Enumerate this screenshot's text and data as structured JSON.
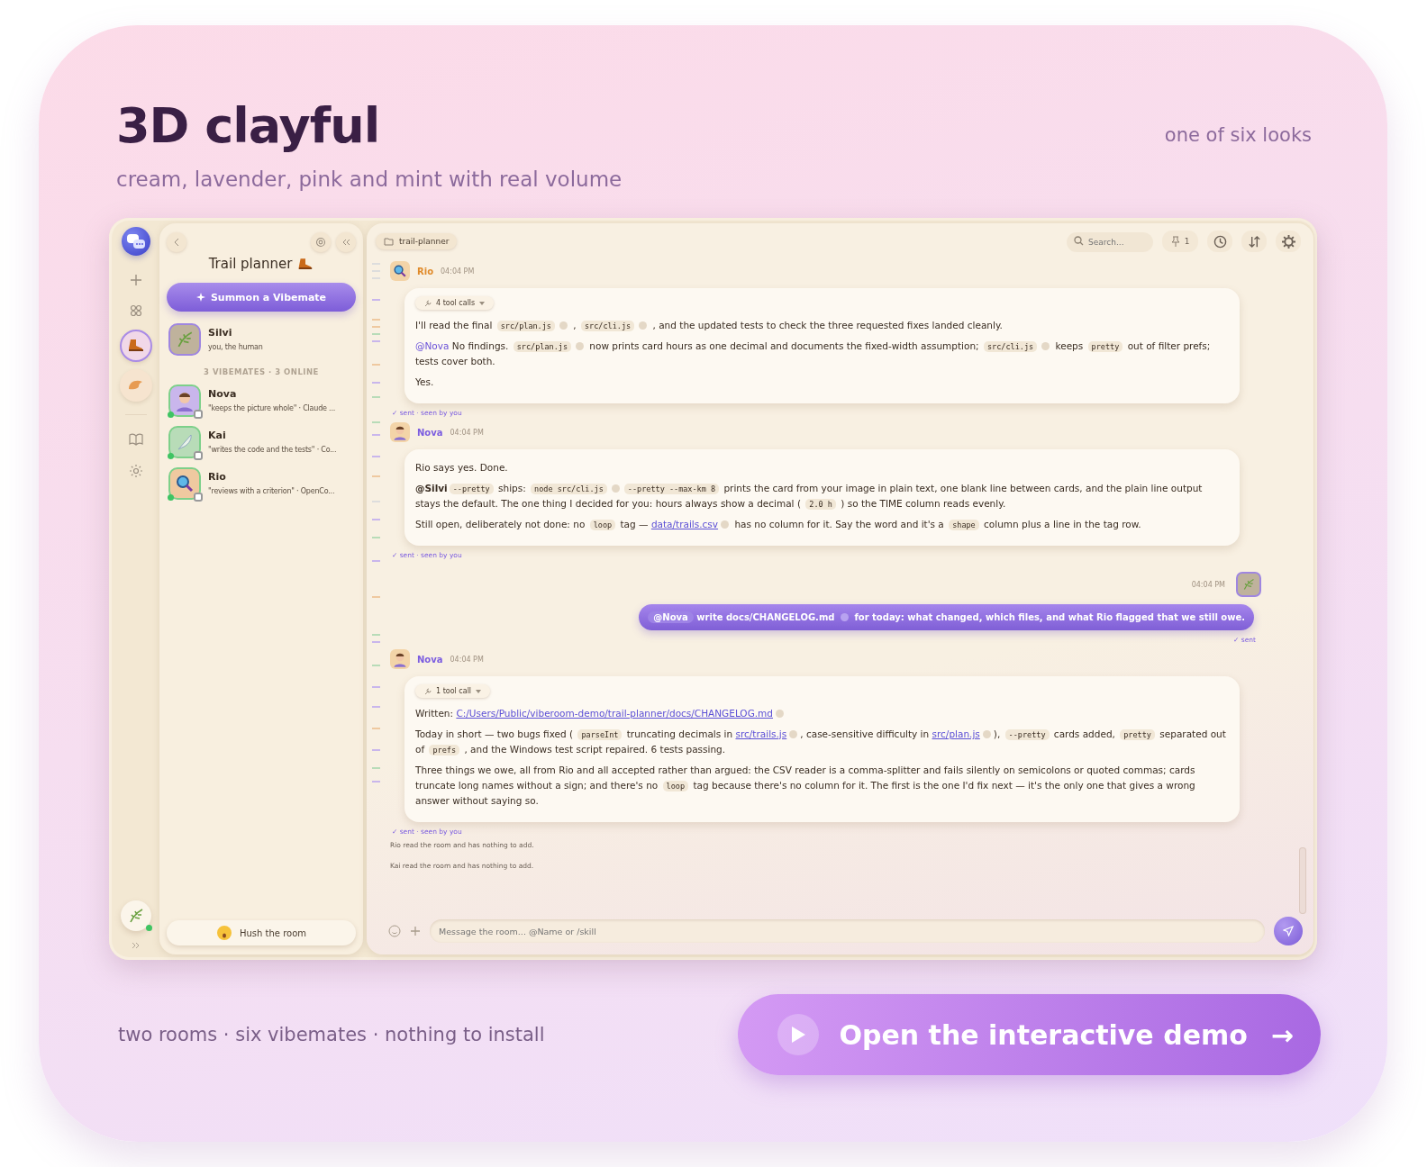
{
  "header": {
    "title": "3D clayful",
    "subtitle": "cream, lavender, pink and mint with real volume",
    "tag": "one of six looks"
  },
  "rail": {
    "rooms": [
      {
        "kind": "boot",
        "selected": true
      },
      {
        "kind": "bun",
        "selected": false
      }
    ],
    "self_online": true
  },
  "sidebar": {
    "title": "Trail planner",
    "summon_button": "Summon a Vibemate",
    "human": {
      "name": "Silvi",
      "note": "you, the human"
    },
    "section_label": "3 VIBEMATES · 3 ONLINE",
    "members": [
      {
        "name": "Nova",
        "note": "\"keeps the picture whole\" · Claude ...",
        "kind": "person",
        "color": "#c9b6ec",
        "online": true
      },
      {
        "name": "Kai",
        "note": "\"writes the code and the tests\" · Co...",
        "kind": "feather",
        "color": "#b8dcb8",
        "online": true
      },
      {
        "name": "Rio",
        "note": "\"reviews with a criterion\" · OpenCo...",
        "kind": "magnifier",
        "color": "#efc9a0",
        "online": true
      }
    ],
    "hush_button": "Hush the room"
  },
  "chat": {
    "channel": "trail-planner",
    "search": {
      "placeholder": "Search..."
    },
    "pin_count": "1",
    "messages": [
      {
        "kind": "agent",
        "author": "Rio",
        "face": {
          "kind": "magnifier"
        },
        "color": "#e08a2a",
        "time": "04:04 PM",
        "tool_calls": "4 tool calls",
        "status": "✓ sent · seen by you",
        "paragraphs": [
          [
            {
              "kind": "text",
              "s": "I'll read the final "
            },
            {
              "kind": "code",
              "s": "src/plan.js"
            },
            {
              "kind": "copy"
            },
            {
              "kind": "text",
              "s": " , "
            },
            {
              "kind": "code",
              "s": "src/cli.js"
            },
            {
              "kind": "copy"
            },
            {
              "kind": "text",
              "s": " , and the updated tests to check the three requested fixes landed cleanly."
            }
          ],
          [
            {
              "kind": "mention",
              "s": "@Nova"
            },
            {
              "kind": "text",
              "s": " No findings. "
            },
            {
              "kind": "code",
              "s": "src/plan.js"
            },
            {
              "kind": "copy"
            },
            {
              "kind": "text",
              "s": " now prints card hours as one decimal and documents the fixed-width assumption; "
            },
            {
              "kind": "code",
              "s": "src/cli.js"
            },
            {
              "kind": "copy"
            },
            {
              "kind": "text",
              "s": " keeps "
            },
            {
              "kind": "code",
              "s": "pretty"
            },
            {
              "kind": "text",
              "s": " out of filter prefs; tests cover both."
            }
          ],
          [
            {
              "kind": "text",
              "s": "Yes."
            }
          ]
        ]
      },
      {
        "kind": "agent",
        "author": "Nova",
        "face": {
          "kind": "person"
        },
        "color": "#7b5ce0",
        "time": "04:04 PM",
        "status": "✓ sent · seen by you",
        "paragraphs": [
          [
            {
              "kind": "text",
              "s": "Rio says yes. Done."
            }
          ],
          [
            {
              "kind": "you",
              "s": "@Silvi"
            },
            {
              "kind": "code",
              "s": "--pretty"
            },
            {
              "kind": "text",
              "s": " ships: "
            },
            {
              "kind": "code",
              "s": "node src/cli.js"
            },
            {
              "kind": "copy"
            },
            {
              "kind": "code",
              "s": "--pretty --max-km 8"
            },
            {
              "kind": "text",
              "s": " prints the card from your image in plain text, one blank line between cards, and the plain line output stays the default. The one thing I decided for you: hours always show a decimal ( "
            },
            {
              "kind": "code",
              "s": "2.0 h"
            },
            {
              "kind": "text",
              "s": " ) so the TIME column reads evenly."
            }
          ],
          [
            {
              "kind": "text",
              "s": "Still open, deliberately not done: no "
            },
            {
              "kind": "code",
              "s": "loop"
            },
            {
              "kind": "text",
              "s": " tag — "
            },
            {
              "kind": "link",
              "s": "data/trails.csv"
            },
            {
              "kind": "copy"
            },
            {
              "kind": "text",
              "s": " has no column for it. Say the word and it's a "
            },
            {
              "kind": "code",
              "s": "shape"
            },
            {
              "kind": "text",
              "s": " column plus a line in the tag row."
            }
          ]
        ]
      },
      {
        "kind": "user",
        "time": "04:04 PM",
        "status": "✓ sent",
        "paragraphs": [
          [
            {
              "kind": "mention",
              "s": "@Nova"
            },
            {
              "kind": "text",
              "s": " write docs/CHANGELOG.md "
            },
            {
              "kind": "copy"
            },
            {
              "kind": "text",
              "s": " for today: what changed, which files, and what Rio flagged that we still owe."
            }
          ]
        ]
      },
      {
        "kind": "agent",
        "author": "Nova",
        "face": {
          "kind": "person"
        },
        "color": "#7b5ce0",
        "time": "04:04 PM",
        "tool_calls": "1 tool call",
        "status": "✓ sent · seen by you",
        "paragraphs": [
          [
            {
              "kind": "text",
              "s": "Written: "
            },
            {
              "kind": "link",
              "s": "C:/Users/Public/viberoom-demo/trail-planner/docs/CHANGELOG.md"
            },
            {
              "kind": "copy"
            }
          ],
          [
            {
              "kind": "text",
              "s": "Today in short — two bugs fixed ( "
            },
            {
              "kind": "code",
              "s": "parseInt"
            },
            {
              "kind": "text",
              "s": " truncating decimals in "
            },
            {
              "kind": "link",
              "s": "src/trails.js"
            },
            {
              "kind": "copy"
            },
            {
              "kind": "text",
              "s": ", case-sensitive difficulty in "
            },
            {
              "kind": "link",
              "s": "src/plan.js"
            },
            {
              "kind": "copy"
            },
            {
              "kind": "text",
              "s": "), "
            },
            {
              "kind": "code",
              "s": "--pretty"
            },
            {
              "kind": "text",
              "s": " cards added, "
            },
            {
              "kind": "code",
              "s": "pretty"
            },
            {
              "kind": "text",
              "s": " separated out of "
            },
            {
              "kind": "code",
              "s": "prefs"
            },
            {
              "kind": "text",
              "s": " , and the Windows test script repaired. 6 tests passing."
            }
          ],
          [
            {
              "kind": "text",
              "s": "Three things we owe, all from Rio and all accepted rather than argued: the CSV reader is a comma-splitter and fails silently on semicolons or quoted commas; cards truncate long names without a sign; and there's no "
            },
            {
              "kind": "code",
              "s": "loop"
            },
            {
              "kind": "text",
              "s": " tag because there's no column for it. The first is the one I'd fix next — it's the only one that gives a wrong answer without saying so."
            }
          ]
        ]
      },
      {
        "kind": "system",
        "text": "Rio read the room and has nothing to add."
      },
      {
        "kind": "system",
        "text": "Kai read the room and has nothing to add."
      }
    ],
    "composer": {
      "placeholder": "Message the room... @Name or /skill"
    }
  },
  "footer": {
    "note": "two rooms · six vibemates · nothing to install",
    "cta": "Open the interactive demo",
    "cta_arrow": "→"
  }
}
